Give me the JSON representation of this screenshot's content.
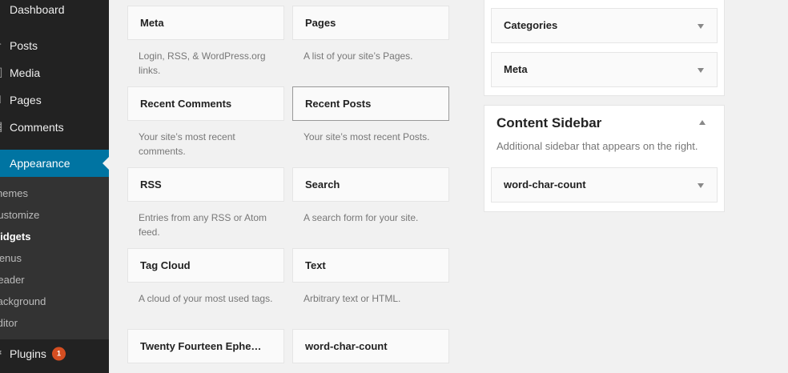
{
  "admin_menu": {
    "items": [
      {
        "label": "Dashboard",
        "icon": "dashboard-icon"
      },
      {
        "label": "Posts",
        "icon": "posts-icon"
      },
      {
        "label": "Media",
        "icon": "media-icon"
      },
      {
        "label": "Pages",
        "icon": "pages-icon"
      },
      {
        "label": "Comments",
        "icon": "comments-icon"
      },
      {
        "label": "Appearance",
        "icon": "appearance-icon"
      },
      {
        "label": "Plugins",
        "icon": "plugins-icon"
      }
    ],
    "appearance_submenu": [
      {
        "label": "Themes"
      },
      {
        "label": "Customize"
      },
      {
        "label": "Widgets"
      },
      {
        "label": "Menus"
      },
      {
        "label": "Header"
      },
      {
        "label": "Background"
      },
      {
        "label": "Editor"
      }
    ],
    "plugins_update_count": "1"
  },
  "available_widgets": [
    {
      "title": "Meta",
      "description": "Login, RSS, & WordPress.org links."
    },
    {
      "title": "Pages",
      "description": "A list of your site’s Pages."
    },
    {
      "title": "Recent Comments",
      "description": "Your site’s most recent comments."
    },
    {
      "title": "Recent Posts",
      "description": "Your site’s most recent Posts."
    },
    {
      "title": "RSS",
      "description": "Entries from any RSS or Atom feed."
    },
    {
      "title": "Search",
      "description": "A search form for your site."
    },
    {
      "title": "Tag Cloud",
      "description": "A cloud of your most used tags."
    },
    {
      "title": "Text",
      "description": "Arbitrary text or HTML."
    },
    {
      "title": "Twenty Fourteen Ephe…",
      "description": ""
    },
    {
      "title": "word-char-count",
      "description": ""
    }
  ],
  "primary_sidebar": {
    "widgets": [
      {
        "title": "Categories"
      },
      {
        "title": "Meta"
      }
    ]
  },
  "content_sidebar": {
    "title": "Content Sidebar",
    "description": "Additional sidebar that appears on the right.",
    "widgets": [
      {
        "title": "word-char-count"
      }
    ]
  }
}
